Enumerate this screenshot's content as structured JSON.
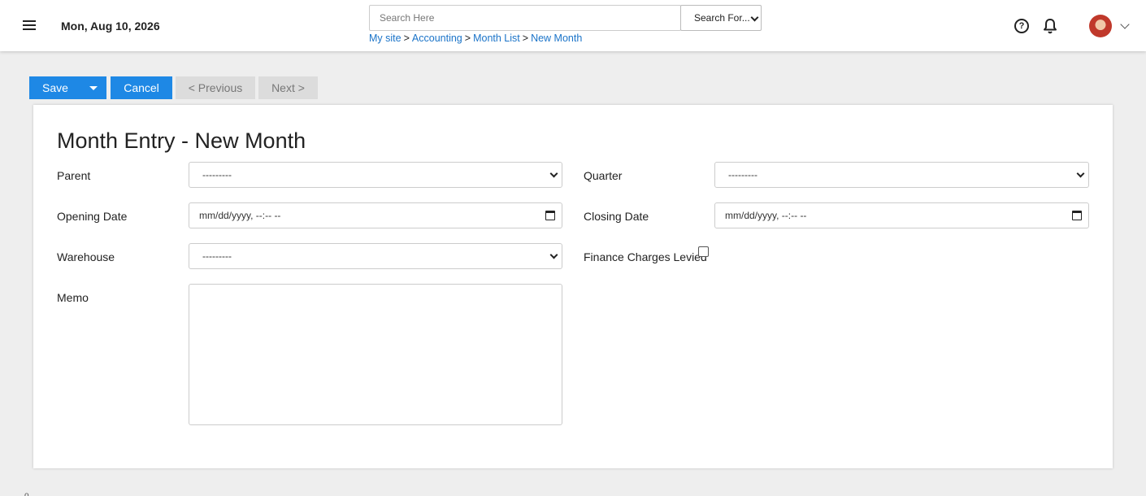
{
  "header": {
    "date": "Mon, Aug 10, 2026",
    "search": {
      "placeholder": "Search Here",
      "value": ""
    },
    "search_for": "Search For...",
    "breadcrumb": [
      "My site",
      "Accounting",
      "Month List",
      "New Month"
    ],
    "help_icon": "help-circle-icon",
    "notification_icon": "bell-icon",
    "menu_icon": "hamburger-icon"
  },
  "toolbar": {
    "save_label": "Save",
    "cancel_label": "Cancel",
    "previous_label": "< Previous",
    "next_label": "Next >"
  },
  "form": {
    "title": "Month Entry - New Month",
    "parent_label": "Parent",
    "parent_value": "---------",
    "quarter_label": "Quarter",
    "quarter_value": "---------",
    "opening_date_label": "Opening Date",
    "opening_date_value": "mm/dd/yyyy, --:-- --",
    "closing_date_label": "Closing Date",
    "closing_date_value": "mm/dd/yyyy, --:-- --",
    "warehouse_label": "Warehouse",
    "warehouse_value": "---------",
    "finance_charges_label": "Finance Charges Levied",
    "finance_charges_checked": false,
    "memo_label": "Memo",
    "memo_value": ""
  },
  "colors": {
    "primary": "#1e88e5",
    "link": "#1a73c8",
    "disabled": "#dcdcdc"
  },
  "footer_mark": "o"
}
